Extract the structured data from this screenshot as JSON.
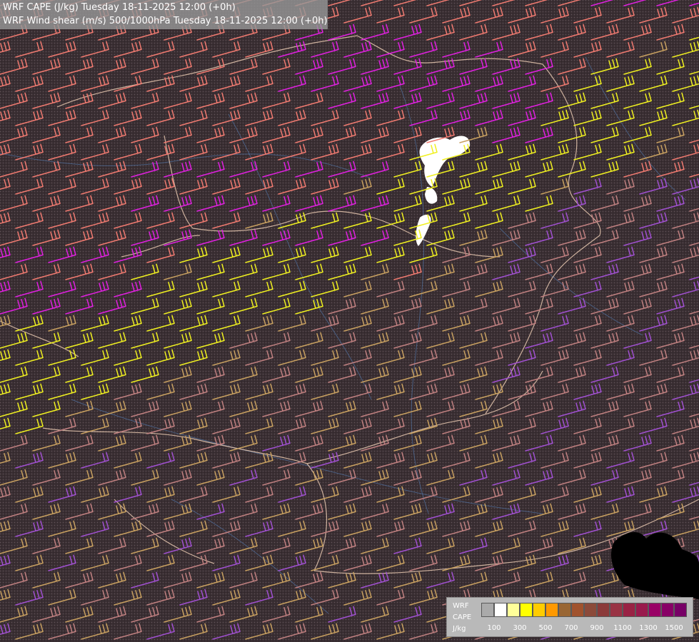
{
  "header": {
    "title_line_1": "WRF CAPE (J/kg) Tuesday 18-11-2025 12:00 (+0h)",
    "title_line_2": "WRF Wind shear (m/s) 500/1000hPa Tuesday 18-11-2025 12:00 (+0h)"
  },
  "legend": {
    "label_lines": [
      "WRF",
      "CAPE",
      "J/kg"
    ],
    "swatch_colors": [
      "#aaaaaa",
      "#ffffff",
      "#ffff99",
      "#ffff00",
      "#ffcc00",
      "#ff9900",
      "#996633",
      "#a0522d",
      "#8b4a3a",
      "#8b3a3a",
      "#993344",
      "#992244",
      "#991a4d",
      "#990066",
      "#880066",
      "#770066"
    ],
    "tick_labels": [
      "100",
      "300",
      "500",
      "700",
      "900",
      "1100",
      "1300",
      "1500"
    ]
  },
  "colors": {
    "background": "#3a2f33",
    "barb_magenta": "#e020e0",
    "barb_salmon": "#f07a70",
    "barb_yellow": "#f0f020",
    "barb_tan": "#c8a060",
    "barb_purple": "#a050d0",
    "barb_rose": "#c08080",
    "border_line": "#e8c8b0",
    "river_line": "#5070a0",
    "cape_patch": "#ffffff"
  }
}
